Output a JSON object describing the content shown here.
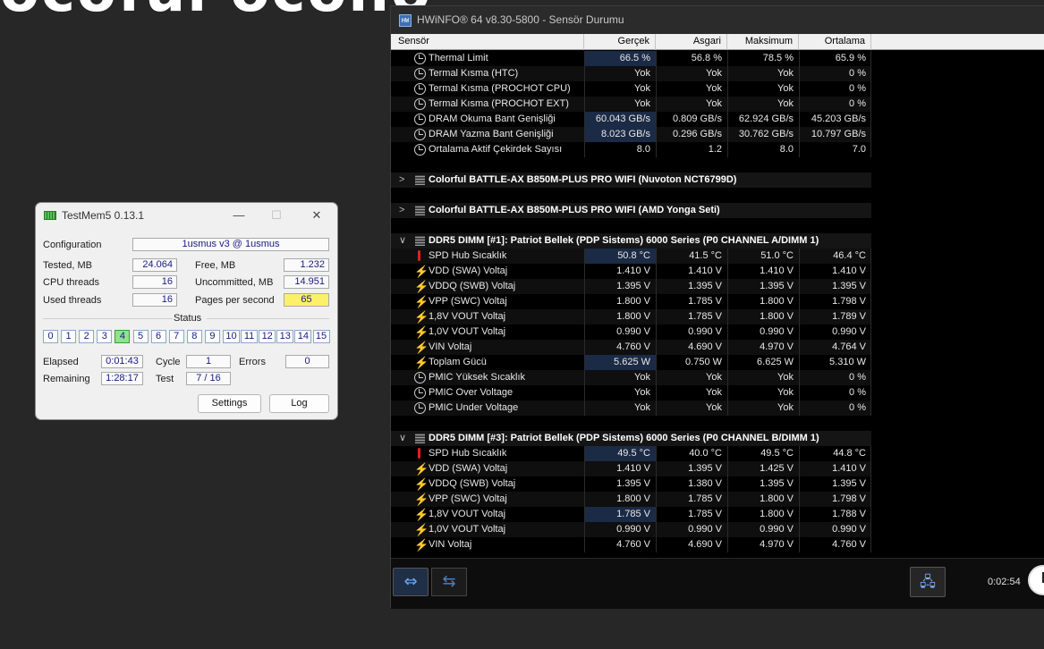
{
  "background": {
    "partial_text": "ocoful ocoho"
  },
  "testmem": {
    "title": "TestMem5  0.13.1",
    "window_controls": {
      "minimize": "—",
      "maximize": "☐",
      "close": "✕"
    },
    "configuration_label": "Configuration",
    "configuration_value": "1usmus v3 @ 1usmus",
    "tested_label": "Tested, MB",
    "tested_value": "24.064",
    "free_label": "Free, MB",
    "free_value": "1.232",
    "cpu_threads_label": "CPU threads",
    "cpu_threads_value": "16",
    "uncommitted_label": "Uncommitted, MB",
    "uncommitted_value": "14.951",
    "used_threads_label": "Used threads",
    "used_threads_value": "16",
    "pps_label": "Pages per second",
    "pps_value": "65",
    "status_label": "Status",
    "status_cells": [
      "0",
      "1",
      "2",
      "3",
      "4",
      "5",
      "6",
      "7",
      "8",
      "9",
      "10",
      "11",
      "12",
      "13",
      "14",
      "15"
    ],
    "status_active": "4",
    "elapsed_label": "Elapsed",
    "elapsed_value": "0:01:43",
    "cycle_label": "Cycle",
    "cycle_value": "1",
    "errors_label": "Errors",
    "errors_value": "0",
    "remaining_label": "Remaining",
    "remaining_value": "1:28:17",
    "test_label": "Test",
    "test_value": "7 / 16",
    "settings_button": "Settings",
    "log_button": "Log"
  },
  "hwinfo": {
    "title": "HWiNFO® 64 v8.30-5800 - Sensör Durumu",
    "icon_text": "HW",
    "columns": [
      "Sensör",
      "Gerçek",
      "Asgari",
      "Maksimum",
      "Ortalama"
    ],
    "rows": [
      {
        "type": "sensor",
        "icon": "clock-icon",
        "name": "Thermal Limit",
        "values": [
          "66.5 %",
          "56.8 %",
          "78.5 %",
          "65.9 %"
        ],
        "hi": true
      },
      {
        "type": "sensor",
        "icon": "clock-icon",
        "name": "Termal Kısma (HTC)",
        "values": [
          "Yok",
          "Yok",
          "Yok",
          "0 %"
        ]
      },
      {
        "type": "sensor",
        "icon": "clock-icon",
        "name": "Termal Kısma (PROCHOT CPU)",
        "values": [
          "Yok",
          "Yok",
          "Yok",
          "0 %"
        ]
      },
      {
        "type": "sensor",
        "icon": "clock-icon",
        "name": "Termal Kısma (PROCHOT EXT)",
        "values": [
          "Yok",
          "Yok",
          "Yok",
          "0 %"
        ]
      },
      {
        "type": "sensor",
        "icon": "clock-icon",
        "name": "DRAM Okuma Bant Genişliği",
        "values": [
          "60.043 GB/s",
          "0.809 GB/s",
          "62.924 GB/s",
          "45.203 GB/s"
        ],
        "hi": true
      },
      {
        "type": "sensor",
        "icon": "clock-icon",
        "name": "DRAM Yazma Bant Genişliği",
        "values": [
          "8.023 GB/s",
          "0.296 GB/s",
          "30.762 GB/s",
          "10.797 GB/s"
        ],
        "hi": true
      },
      {
        "type": "sensor",
        "icon": "clock-icon",
        "name": "Ortalama Aktif Çekirdek Sayısı",
        "values": [
          "8.0",
          "1.2",
          "8.0",
          "7.0"
        ]
      },
      {
        "type": "gap"
      },
      {
        "type": "group",
        "chev": ">",
        "name": "Colorful BATTLE-AX B850M-PLUS PRO WIFI (Nuvoton NCT6799D)"
      },
      {
        "type": "gap"
      },
      {
        "type": "group",
        "chev": ">",
        "name": "Colorful BATTLE-AX B850M-PLUS PRO WIFI (AMD Yonga Seti)"
      },
      {
        "type": "gap"
      },
      {
        "type": "group",
        "chev": "∨",
        "name": "DDR5 DIMM [#1]: Patriot Bellek (PDP Sistems) 6000 Series (P0 CHANNEL A/DIMM 1)"
      },
      {
        "type": "sensor",
        "icon": "thermometer-icon",
        "name": "SPD Hub Sıcaklık",
        "values": [
          "50.8 °C",
          "41.5 °C",
          "51.0 °C",
          "46.4 °C"
        ],
        "hi": true
      },
      {
        "type": "sensor",
        "icon": "bolt-icon",
        "name": "VDD (SWA) Voltaj",
        "values": [
          "1.410 V",
          "1.410 V",
          "1.410 V",
          "1.410 V"
        ]
      },
      {
        "type": "sensor",
        "icon": "bolt-icon",
        "name": "VDDQ (SWB) Voltaj",
        "values": [
          "1.395 V",
          "1.395 V",
          "1.395 V",
          "1.395 V"
        ]
      },
      {
        "type": "sensor",
        "icon": "bolt-icon",
        "name": "VPP (SWC) Voltaj",
        "values": [
          "1.800 V",
          "1.785 V",
          "1.800 V",
          "1.798 V"
        ]
      },
      {
        "type": "sensor",
        "icon": "bolt-icon",
        "name": "1,8V VOUT Voltaj",
        "values": [
          "1.800 V",
          "1.785 V",
          "1.800 V",
          "1.789 V"
        ]
      },
      {
        "type": "sensor",
        "icon": "bolt-icon",
        "name": "1,0V VOUT Voltaj",
        "values": [
          "0.990 V",
          "0.990 V",
          "0.990 V",
          "0.990 V"
        ]
      },
      {
        "type": "sensor",
        "icon": "bolt-icon",
        "name": "VIN Voltaj",
        "values": [
          "4.760 V",
          "4.690 V",
          "4.970 V",
          "4.764 V"
        ]
      },
      {
        "type": "sensor",
        "icon": "bolt-icon",
        "name": "Toplam Gücü",
        "values": [
          "5.625 W",
          "0.750 W",
          "6.625 W",
          "5.310 W"
        ],
        "hi": true
      },
      {
        "type": "sensor",
        "icon": "clock-icon",
        "name": "PMIC Yüksek Sıcaklık",
        "values": [
          "Yok",
          "Yok",
          "Yok",
          "0 %"
        ]
      },
      {
        "type": "sensor",
        "icon": "clock-icon",
        "name": "PMIC Over Voltage",
        "values": [
          "Yok",
          "Yok",
          "Yok",
          "0 %"
        ]
      },
      {
        "type": "sensor",
        "icon": "clock-icon",
        "name": "PMIC Under Voltage",
        "values": [
          "Yok",
          "Yok",
          "Yok",
          "0 %"
        ]
      },
      {
        "type": "gap"
      },
      {
        "type": "group",
        "chev": "∨",
        "name": "DDR5 DIMM [#3]: Patriot Bellek (PDP Sistems) 6000 Series (P0 CHANNEL B/DIMM 1)"
      },
      {
        "type": "sensor",
        "icon": "thermometer-icon",
        "name": "SPD Hub Sıcaklık",
        "values": [
          "49.5 °C",
          "40.0 °C",
          "49.5 °C",
          "44.8 °C"
        ],
        "hi": true
      },
      {
        "type": "sensor",
        "icon": "bolt-icon",
        "name": "VDD (SWA) Voltaj",
        "values": [
          "1.410 V",
          "1.395 V",
          "1.425 V",
          "1.410 V"
        ]
      },
      {
        "type": "sensor",
        "icon": "bolt-icon",
        "name": "VDDQ (SWB) Voltaj",
        "values": [
          "1.395 V",
          "1.380 V",
          "1.395 V",
          "1.395 V"
        ]
      },
      {
        "type": "sensor",
        "icon": "bolt-icon",
        "name": "VPP (SWC) Voltaj",
        "values": [
          "1.800 V",
          "1.785 V",
          "1.800 V",
          "1.798 V"
        ]
      },
      {
        "type": "sensor",
        "icon": "bolt-icon",
        "name": "1,8V VOUT Voltaj",
        "values": [
          "1.785 V",
          "1.785 V",
          "1.800 V",
          "1.788 V"
        ],
        "hi": true
      },
      {
        "type": "sensor",
        "icon": "bolt-icon",
        "name": "1,0V VOUT Voltaj",
        "values": [
          "0.990 V",
          "0.990 V",
          "0.990 V",
          "0.990 V"
        ]
      },
      {
        "type": "sensor",
        "icon": "bolt-icon",
        "name": "VIN Voltaj",
        "values": [
          "4.760 V",
          "4.690 V",
          "4.970 V",
          "4.760 V"
        ]
      }
    ],
    "toolbar": {
      "expand_icon": "⇔",
      "collapse_icon": "⇆",
      "network_icon": "🖧",
      "timer": "0:02:54"
    }
  }
}
